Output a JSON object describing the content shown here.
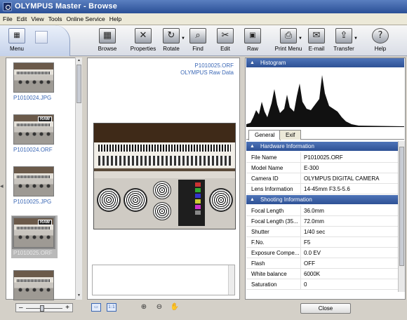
{
  "window": {
    "title": "OLYMPUS Master - Browse"
  },
  "menubar": {
    "items": [
      "File",
      "Edit",
      "View",
      "Tools",
      "Online Service",
      "Help"
    ]
  },
  "toolbar": {
    "menu_label": "Menu",
    "buttons": [
      {
        "label": "Browse",
        "icon": "browse-icon"
      },
      {
        "label": "Properties",
        "icon": "properties-icon"
      },
      {
        "label": "Rotate",
        "icon": "rotate-icon"
      },
      {
        "label": "Find",
        "icon": "find-icon"
      },
      {
        "label": "Edit",
        "icon": "edit-icon"
      },
      {
        "label": "Raw",
        "icon": "raw-icon"
      },
      {
        "label": "Print Menu",
        "icon": "printer-icon"
      },
      {
        "label": "E-mail",
        "icon": "email-icon"
      },
      {
        "label": "Transfer",
        "icon": "transfer-icon"
      },
      {
        "label": "Help",
        "icon": "help-icon"
      }
    ]
  },
  "thumbnails": [
    {
      "name": "P1010024.JPG",
      "raw": false
    },
    {
      "name": "P1010024.ORF",
      "raw": true,
      "badge": "RAW"
    },
    {
      "name": "P1010025.JPG",
      "raw": false
    },
    {
      "name": "P1010025.ORF",
      "raw": true,
      "badge": "RAW",
      "selected": true
    },
    {
      "name": "",
      "raw": false
    }
  ],
  "zoom": {
    "minus": "–",
    "plus": "+"
  },
  "center": {
    "file_name": "P1010025.ORF",
    "file_type": "OLYMPUS Raw Data"
  },
  "histogram": {
    "title": "Histogram"
  },
  "tabs": [
    "General",
    "Exif"
  ],
  "hardware": {
    "title": "Hardware Information",
    "rows": [
      {
        "k": "File Name",
        "v": "P1010025.ORF"
      },
      {
        "k": "Model Name",
        "v": "E-300"
      },
      {
        "k": "Camera ID",
        "v": "OLYMPUS DIGITAL CAMERA"
      },
      {
        "k": "Lens Information",
        "v": "14-45mm F3.5-5.6"
      }
    ]
  },
  "shooting": {
    "title": "Shooting Information",
    "rows": [
      {
        "k": "Focal Length",
        "v": "36.0mm"
      },
      {
        "k": "Focal Length (35...",
        "v": "72.0mm"
      },
      {
        "k": "Shutter",
        "v": "1/40 sec"
      },
      {
        "k": "F.No.",
        "v": "F5"
      },
      {
        "k": "Exposure Compe...",
        "v": "0.0 EV"
      },
      {
        "k": "Flash",
        "v": "OFF"
      },
      {
        "k": "White balance",
        "v": "6000K"
      },
      {
        "k": "Saturation",
        "v": "0"
      }
    ]
  },
  "close_button": "Close"
}
